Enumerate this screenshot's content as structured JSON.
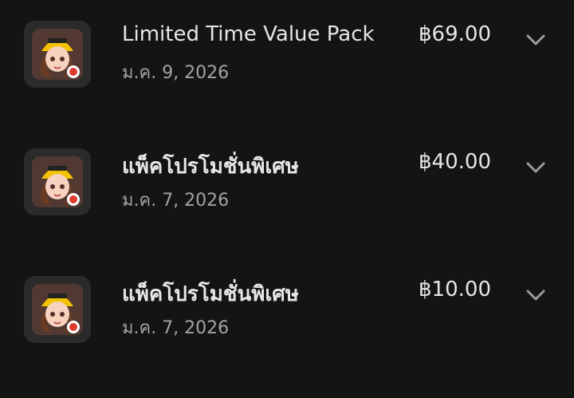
{
  "purchases": [
    {
      "title": "Limited Time Value Pack",
      "date": "ม.ค. 9, 2026",
      "price": "฿69.00",
      "app_icon": "game-avatar-icon",
      "expand_icon": "chevron-down-icon"
    },
    {
      "title": "แพ็คโปรโมชั่นพิเศษ",
      "date": "ม.ค. 7, 2026",
      "price": "฿40.00",
      "app_icon": "game-avatar-icon",
      "expand_icon": "chevron-down-icon"
    },
    {
      "title": "แพ็คโปรโมชั่นพิเศษ",
      "date": "ม.ค. 7, 2026",
      "price": "฿10.00",
      "app_icon": "game-avatar-icon",
      "expand_icon": "chevron-down-icon"
    }
  ],
  "colors": {
    "background": "#141414",
    "primary_text": "#e6e6e6",
    "secondary_text": "#a3a3a3",
    "icon_accent": "#f2c200",
    "brand_red": "#e03a2e"
  }
}
